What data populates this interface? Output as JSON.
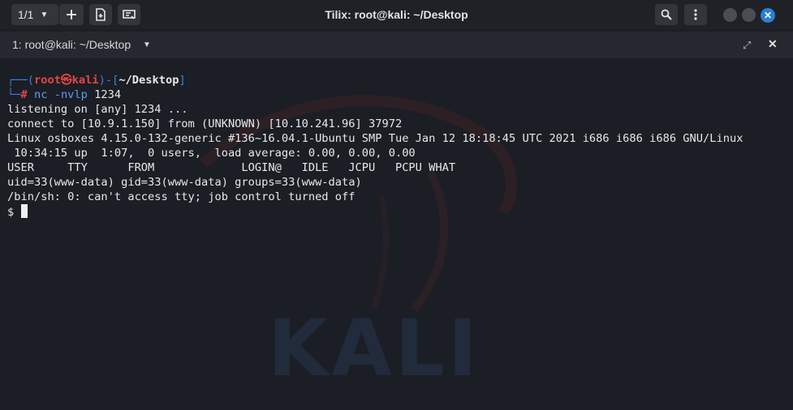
{
  "titlebar": {
    "session_counter": "1/1",
    "title": "Tilix: root@kali: ~/Desktop"
  },
  "tab": {
    "label": "1: root@kali: ~/Desktop"
  },
  "prompt": {
    "corner_top": "┌──(",
    "user": "root㉿kali",
    "sep": ")-[",
    "path": "~/Desktop",
    "close": "]",
    "corner_bottom": "└─",
    "hash": "#",
    "cmd": "nc -nvlp",
    "cmd_arg": "1234"
  },
  "output": [
    "listening on [any] 1234 ...",
    "connect to [10.9.1.150] from (UNKNOWN) [10.10.241.96] 37972",
    "Linux osboxes 4.15.0-132-generic #136~16.04.1-Ubuntu SMP Tue Jan 12 18:18:45 UTC 2021 i686 i686 i686 GNU/Linux",
    " 10:34:15 up  1:07,  0 users,  load average: 0.00, 0.00, 0.00",
    "USER     TTY      FROM             LOGIN@   IDLE   JCPU   PCPU WHAT",
    "uid=33(www-data) gid=33(www-data) groups=33(www-data)",
    "/bin/sh: 0: can't access tty; job control turned off"
  ],
  "shell_prompt": "$",
  "watermark": "KALI",
  "icons": {
    "add": "plus-icon",
    "new_terminal": "new-terminal-icon",
    "sync_input": "sync-input-icon",
    "search": "search-icon",
    "menu": "menu-icon",
    "maximize": "maximize-icon",
    "close": "close-icon"
  },
  "colors": {
    "background": "#1b1e24",
    "prompt_blue": "#3f7ee8",
    "prompt_red": "#e64545",
    "close_button": "#2a7fd4"
  }
}
